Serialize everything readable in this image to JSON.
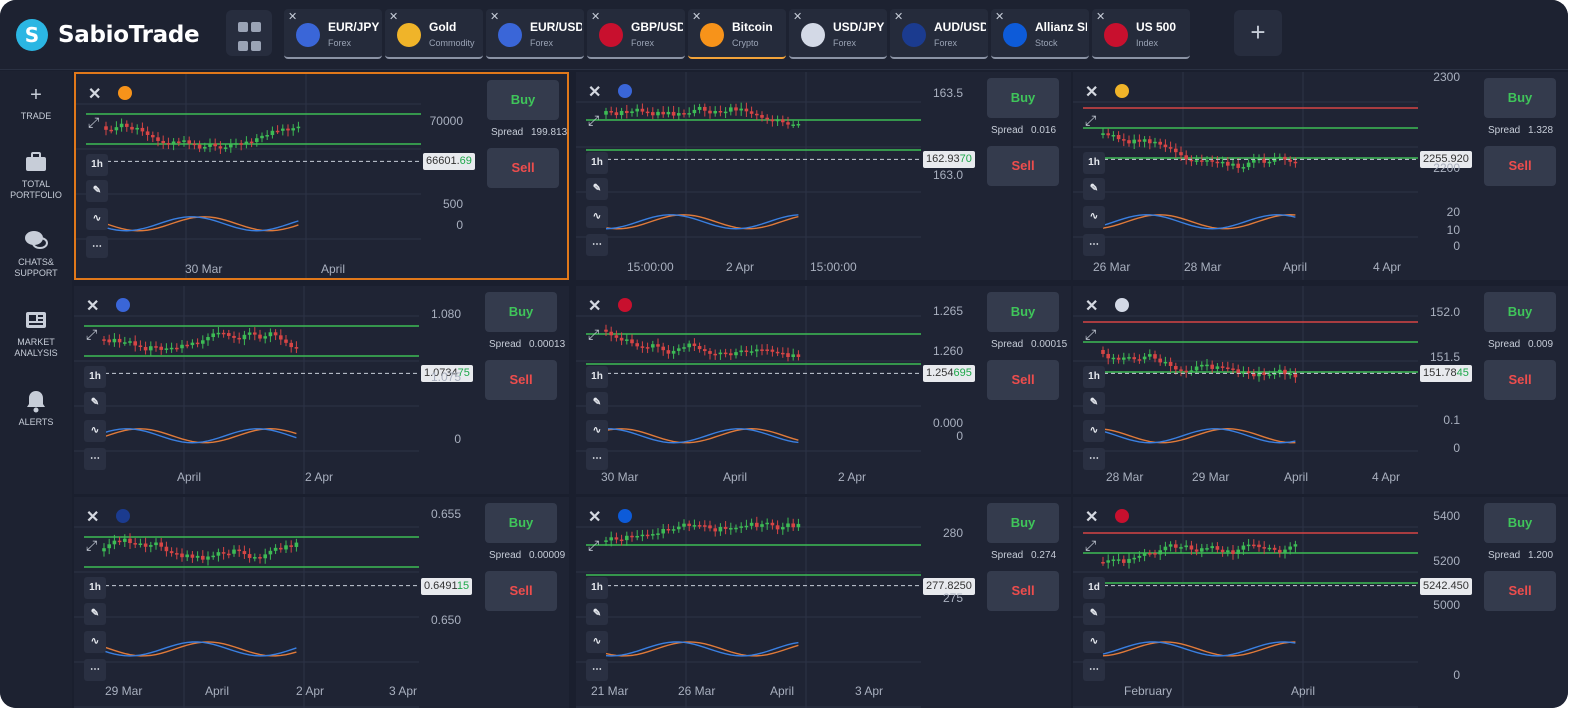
{
  "app": {
    "name": "SabioTrade"
  },
  "tabs": [
    {
      "symbol": "EUR/JPY",
      "type": "Forex",
      "icon": "eur-jpy-flag-icon",
      "color": "#3a66d8"
    },
    {
      "symbol": "Gold",
      "type": "Commodity",
      "icon": "gold-icon",
      "color": "#f0b429"
    },
    {
      "symbol": "EUR/USD",
      "type": "Forex",
      "icon": "eur-usd-flag-icon",
      "color": "#3a66d8"
    },
    {
      "symbol": "GBP/USD",
      "type": "Forex",
      "icon": "gbp-usd-flag-icon",
      "color": "#c8102e"
    },
    {
      "symbol": "Bitcoin",
      "type": "Crypto",
      "icon": "bitcoin-icon",
      "color": "#f7931a"
    },
    {
      "symbol": "USD/JPY",
      "type": "Forex",
      "icon": "usd-jpy-flag-icon",
      "color": "#d3d9e6"
    },
    {
      "symbol": "AUD/USD",
      "type": "Forex",
      "icon": "aud-usd-flag-icon",
      "color": "#1b3b8f"
    },
    {
      "symbol": "Allianz SE",
      "type": "Stock",
      "icon": "allianz-icon",
      "color": "#0d5bd9"
    },
    {
      "symbol": "US 500",
      "type": "Index",
      "icon": "us-flag-icon",
      "color": "#c8102e"
    }
  ],
  "sidebar": [
    {
      "label": "TRADE",
      "icon": "plus-icon"
    },
    {
      "label": "TOTAL PORTFOLIO",
      "icon": "briefcase-icon"
    },
    {
      "label": "CHATS& SUPPORT",
      "icon": "chat-icon"
    },
    {
      "label": "MARKET ANALYSIS",
      "icon": "newspaper-icon"
    },
    {
      "label": "ALERTS",
      "icon": "bell-icon"
    }
  ],
  "buttons": {
    "buy": "Buy",
    "sell": "Sell"
  },
  "panels": [
    {
      "instrument": "Bitcoin",
      "badge": "#f7931a",
      "spread_label": "Spread",
      "spread": "199.813",
      "price_main": "66601.",
      "price_hl": "69",
      "timeframe": "1h",
      "ylabels": [
        "70000",
        "500",
        "0"
      ],
      "xlabels": [
        "30 Mar",
        "April"
      ],
      "tool_counts": [
        "6",
        "1"
      ],
      "selected": true
    },
    {
      "instrument": "EUR/JPY",
      "badge": "#3a66d8",
      "spread_label": "Spread",
      "spread": "0.016",
      "price_main": "162.93",
      "price_hl": "70",
      "timeframe": "1h",
      "ylabels": [
        "163.5",
        "163.0"
      ],
      "xlabels": [
        "15:00:00",
        "2 Apr",
        "15:00:00"
      ],
      "tool_counts": [],
      "selected": false
    },
    {
      "instrument": "Gold",
      "badge": "#f0b429",
      "spread_label": "Spread",
      "spread": "1.328",
      "price_main": "2255.920",
      "price_hl": "",
      "timeframe": "1h",
      "ylabels": [
        "2300",
        "2200",
        "20",
        "10",
        "0"
      ],
      "xlabels": [
        "26 Mar",
        "28 Mar",
        "April",
        "4 Apr"
      ],
      "tool_counts": [
        "8",
        "2"
      ],
      "selected": false
    },
    {
      "instrument": "EUR/USD",
      "badge": "#3a66d8",
      "spread_label": "Spread",
      "spread": "0.00013",
      "price_main": "1.0734",
      "price_hl": "75",
      "timeframe": "1h",
      "ylabels": [
        "1.080",
        "1.075",
        "0"
      ],
      "xlabels": [
        "April",
        "2 Apr"
      ],
      "tool_counts": [
        "4",
        "1"
      ],
      "selected": false
    },
    {
      "instrument": "GBP/USD",
      "badge": "#c8102e",
      "spread_label": "Spread",
      "spread": "0.00015",
      "price_main": "1.254",
      "price_hl": "695",
      "timeframe": "1h",
      "ylabels": [
        "1.265",
        "1.260",
        "0.000",
        "0"
      ],
      "xlabels": [
        "30 Mar",
        "April",
        "2 Apr"
      ],
      "tool_counts": [
        "2",
        "3"
      ],
      "selected": false
    },
    {
      "instrument": "USD/JPY",
      "badge": "#d3d9e6",
      "spread_label": "Spread",
      "spread": "0.009",
      "price_main": "151.78",
      "price_hl": "45",
      "timeframe": "1h",
      "ylabels": [
        "152.0",
        "151.5",
        "0.1",
        "0"
      ],
      "xlabels": [
        "28 Mar",
        "29 Mar",
        "April",
        "4 Apr"
      ],
      "tool_counts": [
        "4",
        "4"
      ],
      "selected": false
    },
    {
      "instrument": "AUD/USD",
      "badge": "#1b3b8f",
      "spread_label": "Spread",
      "spread": "0.00009",
      "price_main": "0.6491",
      "price_hl": "15",
      "timeframe": "1h",
      "ylabels": [
        "0.655",
        "0.650"
      ],
      "xlabels": [
        "29 Mar",
        "April",
        "2 Apr",
        "3 Apr"
      ],
      "tool_counts": [],
      "selected": false
    },
    {
      "instrument": "Allianz SE",
      "badge": "#0d5bd9",
      "spread_label": "Spread",
      "spread": "0.274",
      "price_main": "277.8250",
      "price_hl": "",
      "timeframe": "1h",
      "ylabels": [
        "280",
        "275"
      ],
      "xlabels": [
        "21 Mar",
        "26 Mar",
        "April",
        "3 Apr"
      ],
      "tool_counts": [],
      "selected": false
    },
    {
      "instrument": "US 500",
      "badge": "#c8102e",
      "spread_label": "Spread",
      "spread": "1.200",
      "price_main": "5242.450",
      "price_hl": "",
      "timeframe": "1d",
      "ylabels": [
        "5400",
        "5200",
        "5000",
        "0"
      ],
      "xlabels": [
        "February",
        "April"
      ],
      "tool_counts": [
        "7",
        "2"
      ],
      "selected": false
    }
  ]
}
